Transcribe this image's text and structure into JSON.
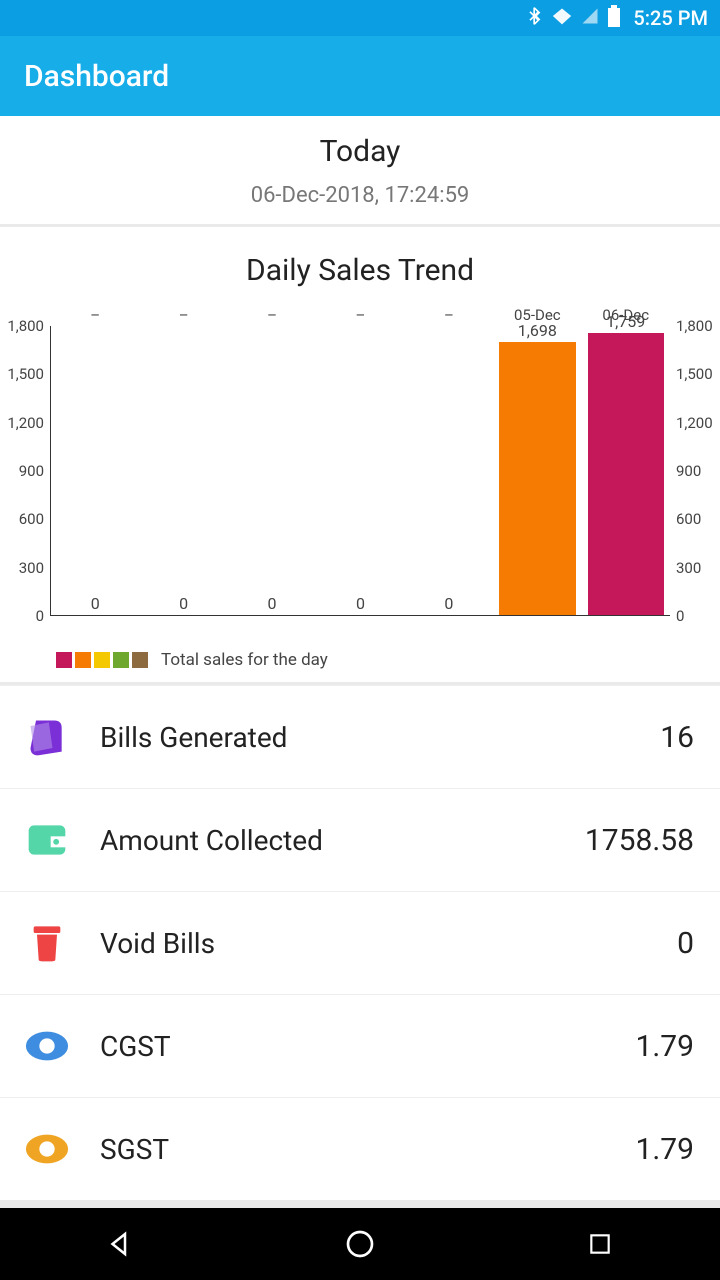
{
  "status": {
    "time": "5:25 PM"
  },
  "header": {
    "title": "Dashboard"
  },
  "today": {
    "title": "Today",
    "timestamp": "06-Dec-2018, 17:24:59"
  },
  "chart_data": {
    "type": "bar",
    "title": "Daily Sales Trend",
    "categories": [
      "–",
      "–",
      "–",
      "–",
      "–",
      "05-Dec",
      "06-Dec"
    ],
    "values": [
      0,
      0,
      0,
      0,
      0,
      1698,
      1759
    ],
    "value_labels": [
      "0",
      "0",
      "0",
      "0",
      "0",
      "1,698",
      "1,759"
    ],
    "ylim": [
      0,
      1800
    ],
    "yticks": [
      0,
      300,
      600,
      900,
      1200,
      1500,
      1800
    ],
    "ytick_labels": [
      "0",
      "300",
      "600",
      "900",
      "1,200",
      "1,500",
      "1,800"
    ],
    "bar_colors": [
      "#c5185b",
      "#f57b02",
      "#f5c902",
      "#6fa82e",
      "#8e6a3f",
      "#f57b02",
      "#c5185b"
    ],
    "legend": {
      "label": "Total sales for the day",
      "swatches": [
        "#c5185b",
        "#f57b02",
        "#f5c902",
        "#6fa82e",
        "#8e6a3f"
      ]
    }
  },
  "metrics": [
    {
      "key": "bills",
      "label": "Bills Generated",
      "value": "16"
    },
    {
      "key": "amount",
      "label": "Amount Collected",
      "value": "1758.58"
    },
    {
      "key": "void",
      "label": "Void Bills",
      "value": "0"
    },
    {
      "key": "cgst",
      "label": "CGST",
      "value": "1.79"
    },
    {
      "key": "sgst",
      "label": "SGST",
      "value": "1.79"
    }
  ]
}
